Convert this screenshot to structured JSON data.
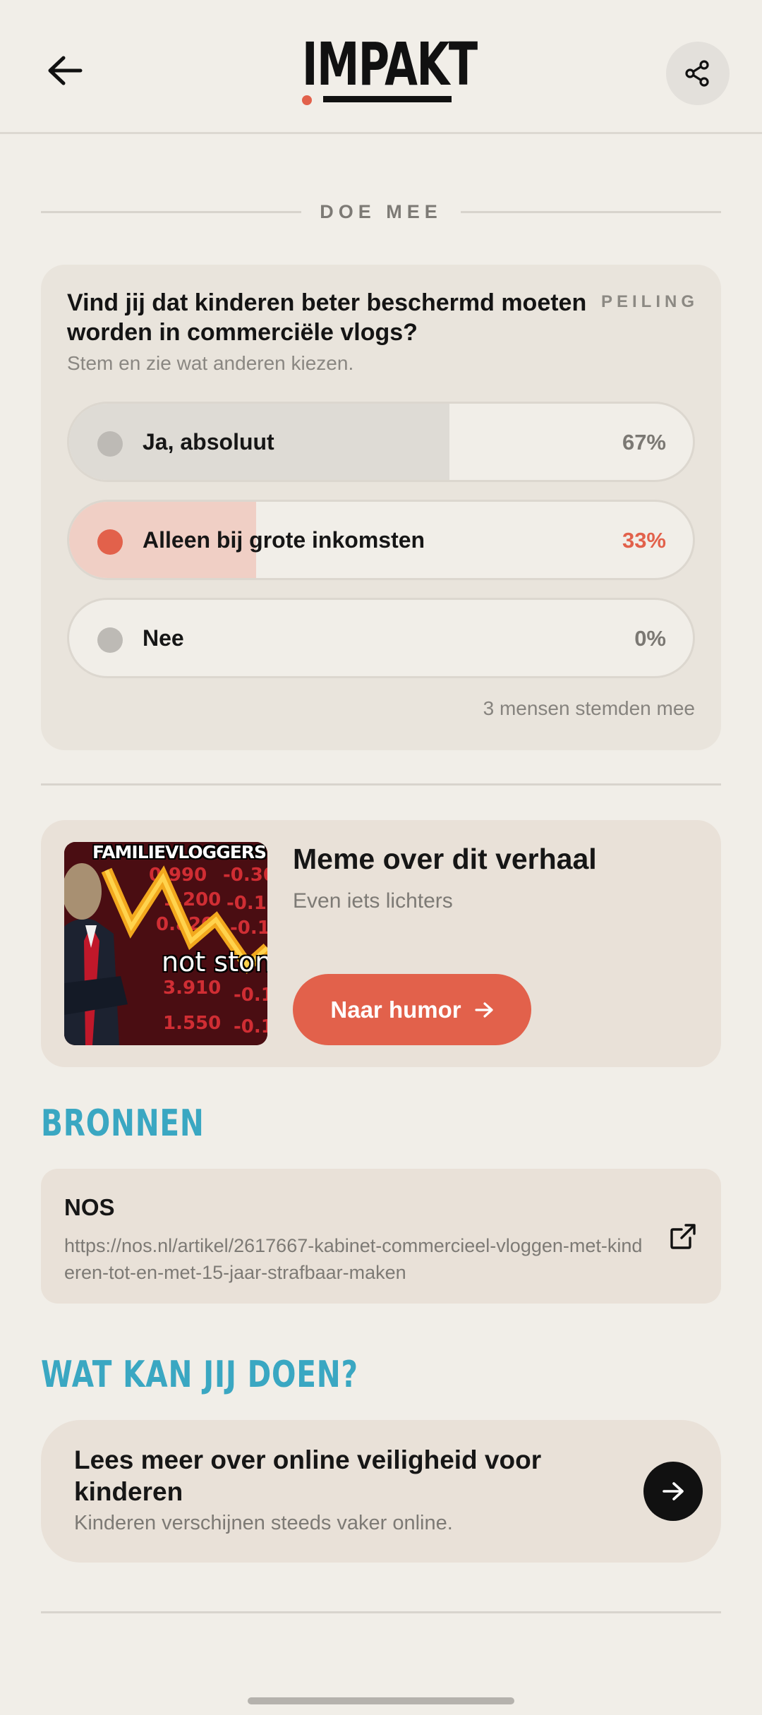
{
  "header": {
    "logo_text": "IMPAKT",
    "back_icon": "arrow-left-icon",
    "share_icon": "share-icon"
  },
  "poll_section": {
    "label": "DOE MEE",
    "tag": "PEILING",
    "question": "Vind jij dat kinderen beter beschermd moeten worden in commerciële vlogs?",
    "subtitle": "Stem en zie wat anderen kiezen.",
    "options": [
      {
        "label": "Ja, absoluut",
        "percent_text": "67%",
        "percent": 61,
        "selected": false
      },
      {
        "label": "Alleen bij grote inkomsten",
        "percent_text": "33%",
        "percent": 30,
        "selected": true
      },
      {
        "label": "Nee",
        "percent_text": "0%",
        "percent": 0,
        "selected": false
      }
    ],
    "votes_text": "3 mensen stemden mee"
  },
  "meme": {
    "title": "Meme over dit verhaal",
    "subtitle": "Even iets lichters",
    "button_label": "Naar humor",
    "image_caption_top": "FAMILIEVLOGGERS",
    "image_caption_bottom": "not stonks"
  },
  "sources": {
    "heading": "BRONNEN",
    "items": [
      {
        "name": "NOS",
        "url": "https://nos.nl/artikel/2617667-kabinet-commercieel-vloggen-met-kinderen-tot-en-met-15-jaar-strafbaar-maken"
      }
    ]
  },
  "actions": {
    "heading": "WAT KAN JIJ DOEN?",
    "items": [
      {
        "title": "Lees meer over online veiligheid voor kinderen",
        "subtitle": "Kinderen verschijnen steeds vaker online."
      }
    ]
  },
  "colors": {
    "background": "#f1eee8",
    "accent": "#e2614b",
    "heading": "#3aa7c2",
    "card": "#e9e4dc"
  }
}
